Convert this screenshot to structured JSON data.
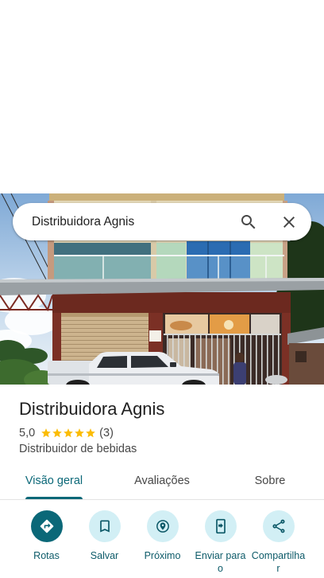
{
  "search": {
    "query": "Distribuidora Agnis",
    "search_icon": "search-icon",
    "close_icon": "close-icon"
  },
  "place": {
    "name": "Distribuidora Agnis",
    "rating": "5,0",
    "stars_filled": 5,
    "stars_total": 5,
    "review_count": "(3)",
    "category": "Distribuidor de bebidas"
  },
  "tabs": [
    {
      "label": "Visão geral",
      "active": true
    },
    {
      "label": "Avaliações",
      "active": false
    },
    {
      "label": "Sobre",
      "active": false
    }
  ],
  "actions": [
    {
      "label": "Rotas",
      "icon": "directions-icon",
      "primary": true
    },
    {
      "label": "Salvar",
      "icon": "bookmark-icon",
      "primary": false
    },
    {
      "label": "Próximo",
      "icon": "nearby-icon",
      "primary": false
    },
    {
      "label": "Enviar para o",
      "icon": "send-to-phone-icon",
      "primary": false
    },
    {
      "label": "Compartilhar",
      "icon": "share-icon",
      "primary": false
    }
  ],
  "colors": {
    "accent": "#0b6878",
    "action_button_bg": "#d2eff5",
    "action_icon": "#0a5766",
    "action_label": "#0d5b69",
    "star": "#fbbc04"
  }
}
